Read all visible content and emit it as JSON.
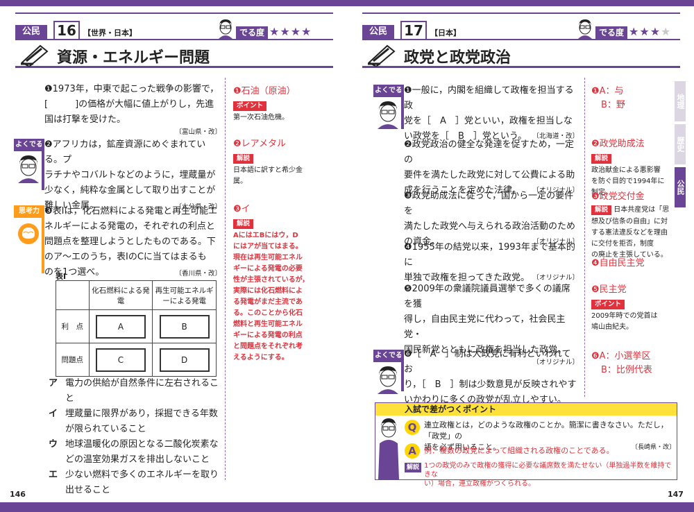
{
  "left": {
    "subject": "公民",
    "number": "16",
    "category": "【世界・日本】",
    "deru_label": "でる度",
    "stars_on": "★★★★",
    "stars_off": "",
    "title": "資源・エネルギー問題",
    "page_number": "146",
    "q1": {
      "text1": "❶1973年，中東で起こった戦争の影響で，",
      "text2": "[　　　]の価格が大幅に値上がりし，先進",
      "text3": "国は打撃を受けた。",
      "source": "〔富山県・改〕"
    },
    "a1": {
      "answer": "❶石油（原油）",
      "tag": "ポイント",
      "note": "第一次石油危機。"
    },
    "q2": {
      "badge": "よくでる",
      "text1": "❷アフリカは，鉱産資源にめぐまれている。プ",
      "text2": "ラチナやコバルトなどのように，埋蔵量が",
      "text3": "少なく，純粋な金属として取り出すことが",
      "text4": "難しい金属。",
      "source": "〔大分県・改〕"
    },
    "a2": {
      "answer": "❷レアメタル",
      "tag": "解説",
      "note1": "日本語に訳すと希少金",
      "note2": "属。"
    },
    "q3": {
      "badge": "思考力",
      "text1": "❸表Ⅰは，化石燃料による発電と再生可能エ",
      "text2": "ネルギーによる発電の，それぞれの利点と",
      "text3": "問題点を整理しようとしたものである。下",
      "text4": "のア～エのうち，表ⅠのCに当てはまるも",
      "text5": "のを1つ選べ。",
      "source": "〔香川県・改〕"
    },
    "table": {
      "caption": "表Ⅰ",
      "col1": "化石燃料による発電",
      "col2": "再生可能エネルギーによる発電",
      "row1": "利　点",
      "row2": "問題点",
      "A": "A",
      "B": "B",
      "C": "C",
      "D": "D"
    },
    "options": [
      {
        "key": "ア",
        "text": "電力の供給が自然条件に左右されること"
      },
      {
        "key": "イ",
        "text": "埋蔵量に限界があり，採掘できる年数が限られていること"
      },
      {
        "key": "ウ",
        "text": "地球温暖化の原因となる二酸化炭素などの温室効果ガスを排出しないこと"
      },
      {
        "key": "エ",
        "text": "少ない燃料で多くのエネルギーを取り出せること"
      }
    ],
    "a3": {
      "answer": "❸イ",
      "tag": "解説",
      "lines": [
        "AにはエBにはウ，D",
        "にはアが当てはまる。",
        "現在は再生可能エネル",
        "ギーによる発電の必要",
        "性が主張されているが，",
        "実際には化石燃料によ",
        "る発電がまだ主流であ",
        "る。このことから化石",
        "燃料と再生可能エネル",
        "ギーによる発電の利点",
        "と問題点をそれぞれ考",
        "えるようにする。"
      ]
    }
  },
  "right": {
    "subject": "公民",
    "number": "17",
    "category": "【日本】",
    "deru_label": "でる度",
    "stars_on": "★★★",
    "stars_off": "★",
    "title": "政党と政党政治",
    "page_number": "147",
    "sidetabs": [
      "地理",
      "歴史",
      "公民"
    ],
    "q1": {
      "badge": "よくでる",
      "text1": "❶一般に，内閣を組織して政権を担当する政",
      "text2": "党を［　A　］党といい，政権を担当しな",
      "text3": "い政党を［　B　］党という。",
      "source": "〔北海道・改〕"
    },
    "a1": {
      "lineA": "❶A：与",
      "lineB": "B：野"
    },
    "q2": {
      "text1": "❷政党政治の健全な発達を促すため，一定の",
      "text2": "要件を満たした政党に対して公費による助",
      "text3": "成を行うことを定めた法律。",
      "source": "〔オリジナル〕"
    },
    "a2": {
      "answer": "❷政党助成法",
      "tag": "解説",
      "note1": "政治献金による悪影響",
      "note2": "を防ぐ目的で1994年に",
      "note3": "制定。"
    },
    "q3": {
      "text1": "❸政党助成法に従って，国から一定の要件を",
      "text2": "満たした政党へ与えられる政治活動のため",
      "text3": "の資金。",
      "source": "〔オリジナル〕"
    },
    "a3": {
      "answer": "❸政党交付金",
      "tag": "解説",
      "note1": "日本共産党は「思",
      "note2": "想及び信条の自由」に対",
      "note3": "する憲法違反などを理由",
      "note4": "に交付を拒否，制度",
      "note5": "の廃止を主張している。"
    },
    "q4": {
      "text1": "❹1955年の結党以来，1993年まで基本的に",
      "text2": "単独で政権を担ってきた政党。",
      "source": "〔オリジナル〕"
    },
    "a4": {
      "answer": "❹自由民主党"
    },
    "q5": {
      "text1": "❺2009年の衆議院議員選挙で多くの議席を獲",
      "text2": "得し，自由民主党に代わって，社会民主党・",
      "text3": "国民新党とともに政権を担当した政党。",
      "source": "〔オリジナル〕"
    },
    "a5": {
      "answer": "❺民主党",
      "tag": "ポイント",
      "note1": "2009年時での党首は",
      "note2": "鳩山由紀夫。"
    },
    "q6": {
      "badge": "よくでる",
      "text1": "❻［　A　］制は大政党に有利といわれてお",
      "text2": "り，［　B　］制は少数意見が反映されやす",
      "text3": "いかわりに多くの政党が乱立しやすい。",
      "source": "〔富山県・改〕"
    },
    "a6": {
      "lineA": "❻A：小選挙区",
      "lineB": "B：比例代表"
    },
    "point_box": {
      "header": "入試で差がつくポイント",
      "q_mark": "Q",
      "q_text1": "連立政権とは，どのような政権のことか。簡潔に書きなさい。ただし，「政党」の",
      "q_text2": "語を必ず用いること。",
      "q_source": "〔長崎県・改〕",
      "a_mark": "A",
      "a_text": "例：複数の政党によって組織される政権のことである。",
      "kai_label": "解説",
      "kai_text1": "1つの政党のみで政権の獲得に必要な議席数を満たせない（単独過半数を維持できな",
      "kai_text2": "い）場合，連立政権がつくられる。"
    }
  },
  "colors": {
    "purple": "#6a4596",
    "red": "#e0323c",
    "orange": "#ff9c1c",
    "yellow": "#ffe13a"
  }
}
